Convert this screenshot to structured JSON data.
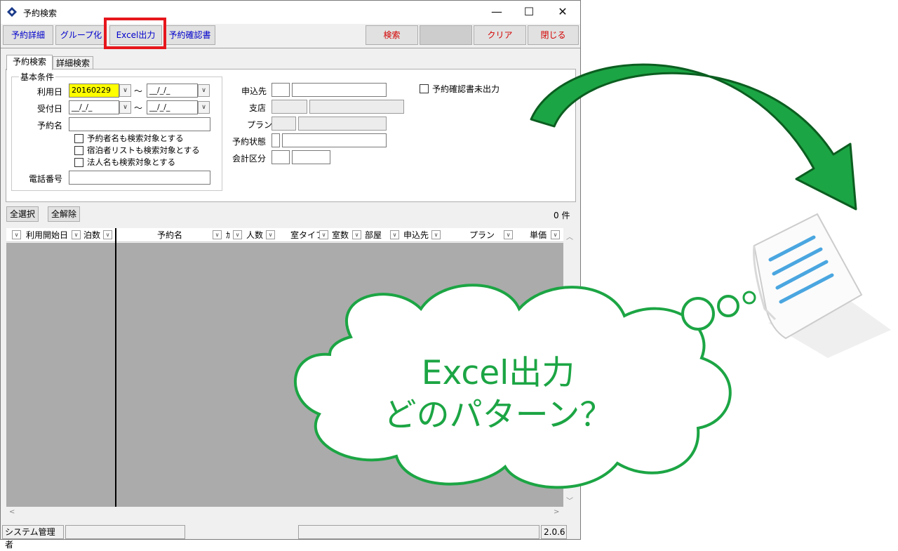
{
  "window": {
    "title": "予約検索",
    "minimize": "—",
    "maximize": "☐",
    "close": "✕"
  },
  "toolbar": {
    "detail": "予約詳細",
    "group": "グループ化",
    "excel": "Excel出力",
    "confirm": "予約確認書",
    "search": "検索",
    "clear": "クリア",
    "close": "閉じる"
  },
  "tabs": [
    "予約検索",
    "詳細検索"
  ],
  "basic": {
    "group_label": "基本条件",
    "use_date_label": "利用日",
    "use_date_from": "20160229",
    "use_date_to": "__/_/_",
    "tilde": "〜",
    "recv_date_label": "受付日",
    "recv_date_from": "__/_/_",
    "recv_date_to": "__/_/_",
    "name_label": "予約名",
    "name_value": "",
    "check_booker": "予約者名も検索対象とする",
    "check_guests": "宿泊者リストも検索対象とする",
    "check_corp": "法人名も検索対象とする",
    "phone_label": "電話番号",
    "phone_value": ""
  },
  "right": {
    "applicant_label": "申込先",
    "branch_label": "支店",
    "plan_label": "プラン",
    "status_label": "予約状態",
    "account_label": "会計区分",
    "unprinted_label": "予約確認書未出力"
  },
  "list": {
    "select_all": "全選択",
    "deselect_all": "全解除",
    "count": "0 件",
    "columns": [
      "利用開始日",
      "泊数",
      "予約名",
      "ｶ",
      "人数",
      "室タイプ",
      "室数",
      "部屋",
      "申込先",
      "プラン",
      "単価"
    ]
  },
  "status": {
    "user": "システム管理者",
    "version": "2.0.6"
  },
  "annotation": {
    "line1": "Excel出力",
    "line2": "どのパターン？"
  },
  "colors": {
    "highlight": "#e6161c",
    "annotation_green": "#1ca544",
    "date_highlight": "#ffff00"
  }
}
